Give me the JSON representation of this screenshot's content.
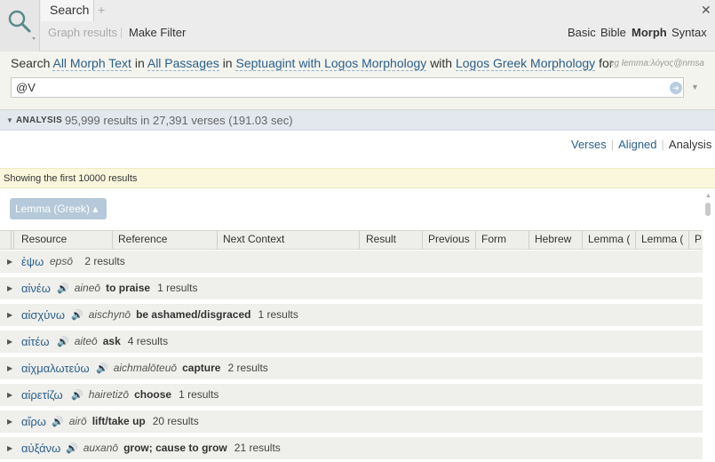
{
  "toolbar": {
    "tab_label": "Search",
    "add_tab": "+",
    "close": "✕",
    "graph_results": "Graph results",
    "make_filter": "Make Filter",
    "modes": [
      "Basic",
      "Bible",
      "Morph",
      "Syntax"
    ],
    "active_mode": "Morph"
  },
  "search": {
    "prefix": "Search",
    "scope": "All Morph Text",
    "in": "in",
    "passages": "All Passages",
    "in2": "in",
    "resource": "Septuagint with Logos Morphology",
    "with": "with",
    "morphology": "Logos Greek Morphology",
    "for": "for",
    "example": "eg lemma:λόγος@nmsa",
    "query": "@V"
  },
  "analysis": {
    "label": "ANALYSIS",
    "stats": "95,999 results in 27,391 verses (191.03 sec)"
  },
  "view_tabs": [
    "Verses",
    "Aligned",
    "Analysis"
  ],
  "active_view": "Analysis",
  "banner": "Showing the first 10000 results",
  "group_by": "Lemma (Greek) ▴",
  "columns": [
    "Resource",
    "Reference",
    "Next Context",
    "Result",
    "Previous",
    "Form",
    "Hebrew",
    "Lemma (",
    "Lemma (",
    "P"
  ],
  "rows": [
    {
      "greek": "ἐψω",
      "translit": "epsō",
      "gloss": "",
      "count": "2 results",
      "audio": false
    },
    {
      "greek": "αἰνέω",
      "translit": "aineō",
      "gloss": "to praise",
      "count": "1 results",
      "audio": true
    },
    {
      "greek": "αἰσχύνω",
      "translit": "aischynō",
      "gloss": "be ashamed/disgraced",
      "count": "1 results",
      "audio": true
    },
    {
      "greek": "αἰτέω",
      "translit": "aiteō",
      "gloss": "ask",
      "count": "4 results",
      "audio": true
    },
    {
      "greek": "αἰχμαλωτεύω",
      "translit": "aichmalōteuō",
      "gloss": "capture",
      "count": "2 results",
      "audio": true
    },
    {
      "greek": "αἱρετίζω",
      "translit": "hairetizō",
      "gloss": "choose",
      "count": "1 results",
      "audio": true
    },
    {
      "greek": "αἴρω",
      "translit": "airō",
      "gloss": "lift/take up",
      "count": "20 results",
      "audio": true
    },
    {
      "greek": "αὐξάνω",
      "translit": "auxanō",
      "gloss": "grow; cause to grow",
      "count": "21 results",
      "audio": true
    }
  ]
}
